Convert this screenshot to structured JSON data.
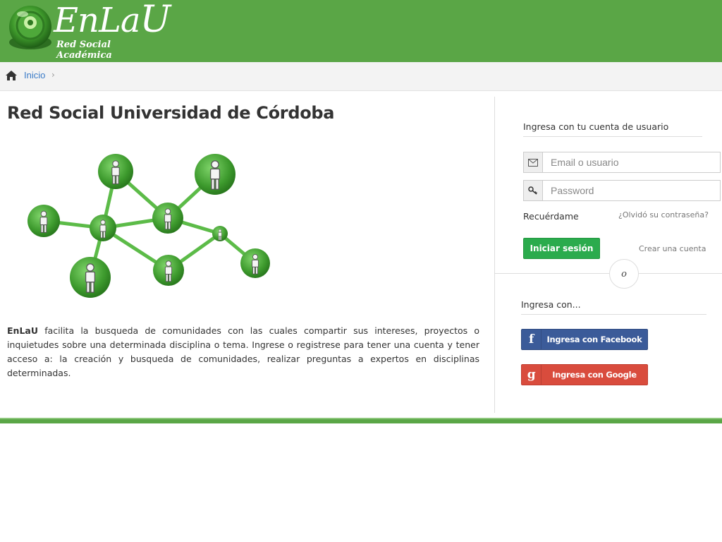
{
  "header": {
    "logo_word": "EnLa",
    "logo_word_u": "U",
    "logo_subtitle": "Red Social Académica",
    "bg_color": "#5aa646"
  },
  "breadcrumb": {
    "home_icon": "home-icon",
    "items": [
      "Inicio"
    ]
  },
  "main": {
    "title": "Red Social Universidad de Córdoba",
    "intro_brand": "EnLaU",
    "intro_text": " facilita la busqueda de comunidades con las cuales compartir sus intereses, proyectos o inquietudes sobre una determinada disciplina o tema. Ingrese o registrese para tener una cuenta y tener acceso a: la creación y busqueda de comunidades, realizar preguntas a expertos en disciplinas determinadas."
  },
  "login": {
    "title": "Ingresa con tu cuenta de usuario",
    "email_placeholder": "Email o usuario",
    "email_value": "",
    "password_placeholder": "Password",
    "password_value": "",
    "remember_label": "Recuérdame",
    "forgot_label": "¿Olvidó su contraseña?",
    "submit_label": "Iniciar sesión",
    "create_label": "Crear una cuenta",
    "or_label": "o"
  },
  "social": {
    "title": "Ingresa con...",
    "facebook_label": "Ingresa con Facebook",
    "facebook_icon": "f",
    "facebook_color": "#3b5b99",
    "google_label": "Ingresa con Google",
    "google_icon": "g",
    "google_color": "#d94c3d"
  }
}
